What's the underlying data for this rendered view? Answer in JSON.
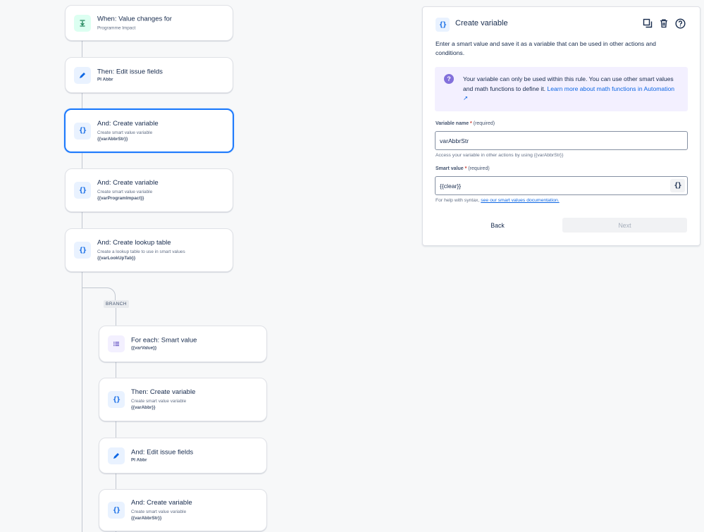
{
  "rule": {
    "branch_label": "BRANCH",
    "cards": [
      {
        "title": "When: Value changes for",
        "sub": "Programme Impact",
        "sub2": ""
      },
      {
        "title": "Then: Edit issue fields",
        "sub": "",
        "sub2": "PI Abbr"
      },
      {
        "title": "And: Create variable",
        "sub": "Create smart value variable",
        "sub2": "{{varAbbrStr}}"
      },
      {
        "title": "And: Create variable",
        "sub": "Create smart value variable",
        "sub2": "{{varProgramImpact}}"
      },
      {
        "title": "And: Create lookup table",
        "sub": "Create a lookup table to use in smart values",
        "sub2": "{{varLookUpTab}}"
      },
      {
        "title": "For each: Smart value",
        "sub": "",
        "sub2": "{{varValue}}"
      },
      {
        "title": "Then: Create variable",
        "sub": "Create smart value variable",
        "sub2": "{{varAbbr}}"
      },
      {
        "title": "And: Edit issue fields",
        "sub": "",
        "sub2": "PI Abbr"
      },
      {
        "title": "And: Create variable",
        "sub": "Create smart value variable",
        "sub2": "{{varAbbrStr}}"
      }
    ]
  },
  "panel": {
    "title": "Create variable",
    "description": "Enter a smart value and save it as a variable that can be used in other actions and conditions.",
    "info_text": "Your variable can only be used within this rule. You can use other smart values and math functions to define it. ",
    "info_link": "Learn more about math functions in Automation ↗",
    "variable_name_label": "Variable name",
    "required_mark": "*",
    "required_text": "(required)",
    "variable_name_value": "varAbbrStr",
    "variable_name_help": "Access your variable in other actions by using {{varAbbrStr}}",
    "smart_value_label": "Smart value",
    "smart_value_value": "{{clear}}",
    "smart_value_help_prefix": "For help with syntax, ",
    "smart_value_help_link": "see our smart values documentation.",
    "back_label": "Back",
    "next_label": "Next"
  },
  "colors": {
    "accent": "#1d7afc",
    "info_bg": "#f3f0ff",
    "info_icon": "#8270db"
  }
}
